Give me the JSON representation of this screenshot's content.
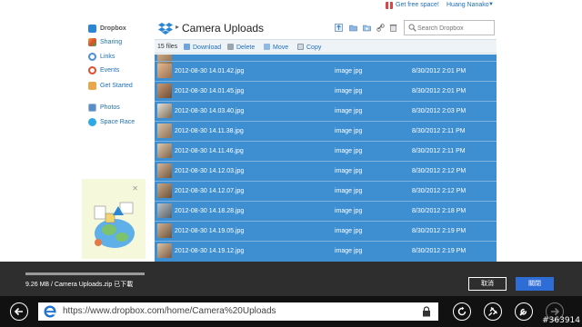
{
  "topnav": {
    "free_space": "Get free space!",
    "user": "Huang Nanako",
    "caret": "▼"
  },
  "sidebar": {
    "items": [
      {
        "label": "Dropbox",
        "icon": "dropbox-icon",
        "color": "#2b86d6",
        "active": true
      },
      {
        "label": "Sharing",
        "icon": "sharing-icon",
        "color": "#f0a030"
      },
      {
        "label": "Links",
        "icon": "links-icon",
        "color": "#4d8fd8"
      },
      {
        "label": "Events",
        "icon": "events-icon",
        "color": "#e04d2e"
      },
      {
        "label": "Get Started",
        "icon": "get-started-icon",
        "color": "#e9a64a"
      },
      {
        "label": "Photos",
        "icon": "photos-icon",
        "color": "#5b8cc6"
      },
      {
        "label": "Space Race",
        "icon": "space-race-icon",
        "color": "#2fa9e6"
      }
    ]
  },
  "header": {
    "title": "Camera Uploads",
    "search_placeholder": "Search Dropbox"
  },
  "actions": {
    "count": "15 files",
    "download": "Download",
    "delete": "Delete",
    "move": "Move",
    "copy": "Copy"
  },
  "files": [
    {
      "name": "2012-08-30 14.01.42.jpg",
      "kind": "image   jpg",
      "modified": "8/30/2012 2:01 PM"
    },
    {
      "name": "2012-08-30 14.01.45.jpg",
      "kind": "image   jpg",
      "modified": "8/30/2012 2:01 PM"
    },
    {
      "name": "2012-08-30 14.03.40.jpg",
      "kind": "image   jpg",
      "modified": "8/30/2012 2:03 PM"
    },
    {
      "name": "2012-08-30 14.11.38.jpg",
      "kind": "image   jpg",
      "modified": "8/30/2012 2:11 PM"
    },
    {
      "name": "2012-08-30 14.11.46.jpg",
      "kind": "image   jpg",
      "modified": "8/30/2012 2:11 PM"
    },
    {
      "name": "2012-08-30 14.12.03.jpg",
      "kind": "image   jpg",
      "modified": "8/30/2012 2:12 PM"
    },
    {
      "name": "2012-08-30 14.12.07.jpg",
      "kind": "image   jpg",
      "modified": "8/30/2012 2:12 PM"
    },
    {
      "name": "2012-08-30 14.18.28.jpg",
      "kind": "image   jpg",
      "modified": "8/30/2012 2:18 PM"
    },
    {
      "name": "2012-08-30 14.19.05.jpg",
      "kind": "image   jpg",
      "modified": "8/30/2012 2:19 PM"
    },
    {
      "name": "2012-08-30 14.19.12.jpg",
      "kind": "image   jpg",
      "modified": "8/30/2012 2:19 PM"
    }
  ],
  "download": {
    "status": "9.26 MB / Camera Uploads.zip 已下載",
    "progress": 1.0,
    "cancel_label": "取消",
    "close_label": "關閉"
  },
  "browser": {
    "url": "https://www.dropbox.com/home/Camera%20Uploads"
  },
  "watermark": "#363914",
  "colors": {
    "selection": "#3d8fd1",
    "link": "#1f6fb5",
    "accent_button": "#2f6dd6"
  }
}
